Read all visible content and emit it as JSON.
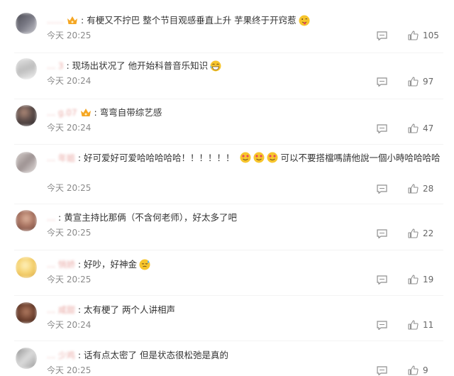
{
  "comments": [
    {
      "user": "……",
      "text": "有梗又不拧巴 整个节目观感垂直上升 芋果终于开窍惹",
      "time": "今天 20:25",
      "likes": "105",
      "vip": true,
      "emoji": "tongue-icon"
    },
    {
      "user": "… 3",
      "text": "现场出状况了 他开始科普音乐知识",
      "time": "今天 20:24",
      "likes": "97",
      "vip": false,
      "emoji": "laugh-icon"
    },
    {
      "user": "… g.07",
      "text": "弯弯自带综艺感",
      "time": "今天 20:24",
      "likes": "47",
      "vip": true,
      "emoji": ""
    },
    {
      "user": "… 年姐",
      "text": "好可爱好可爱哈哈哈哈哈！！！！！！",
      "text2": "可以不要搭檔嗎請他說一個小時哈哈哈哈",
      "time": "今天 20:25",
      "likes": "28",
      "vip": false,
      "emoji": "heart-eyes-icon"
    },
    {
      "user": "…",
      "text": "黄宣主持比那俩（不含何老师），好太多了吧",
      "time": "今天 20:25",
      "likes": "22",
      "vip": false,
      "emoji": ""
    },
    {
      "user": "… 悄娇",
      "text": "好吵，好神金",
      "time": "今天 20:25",
      "likes": "19",
      "vip": false,
      "emoji": "sweat-icon"
    },
    {
      "user": "… 咸甜",
      "text": "太有梗了 两个人讲相声",
      "time": "今天 20:24",
      "likes": "11",
      "vip": false,
      "emoji": ""
    },
    {
      "user": "… 少鸡",
      "text": "话有点太密了 但是状态很松弛是真的",
      "time": "今天 20:25",
      "likes": "9",
      "vip": false,
      "emoji": ""
    }
  ],
  "colors": {
    "time": "#8a8a8a",
    "username": "#e9a9a5",
    "icon": "#8f8f8f",
    "vip": "#f5a623"
  }
}
